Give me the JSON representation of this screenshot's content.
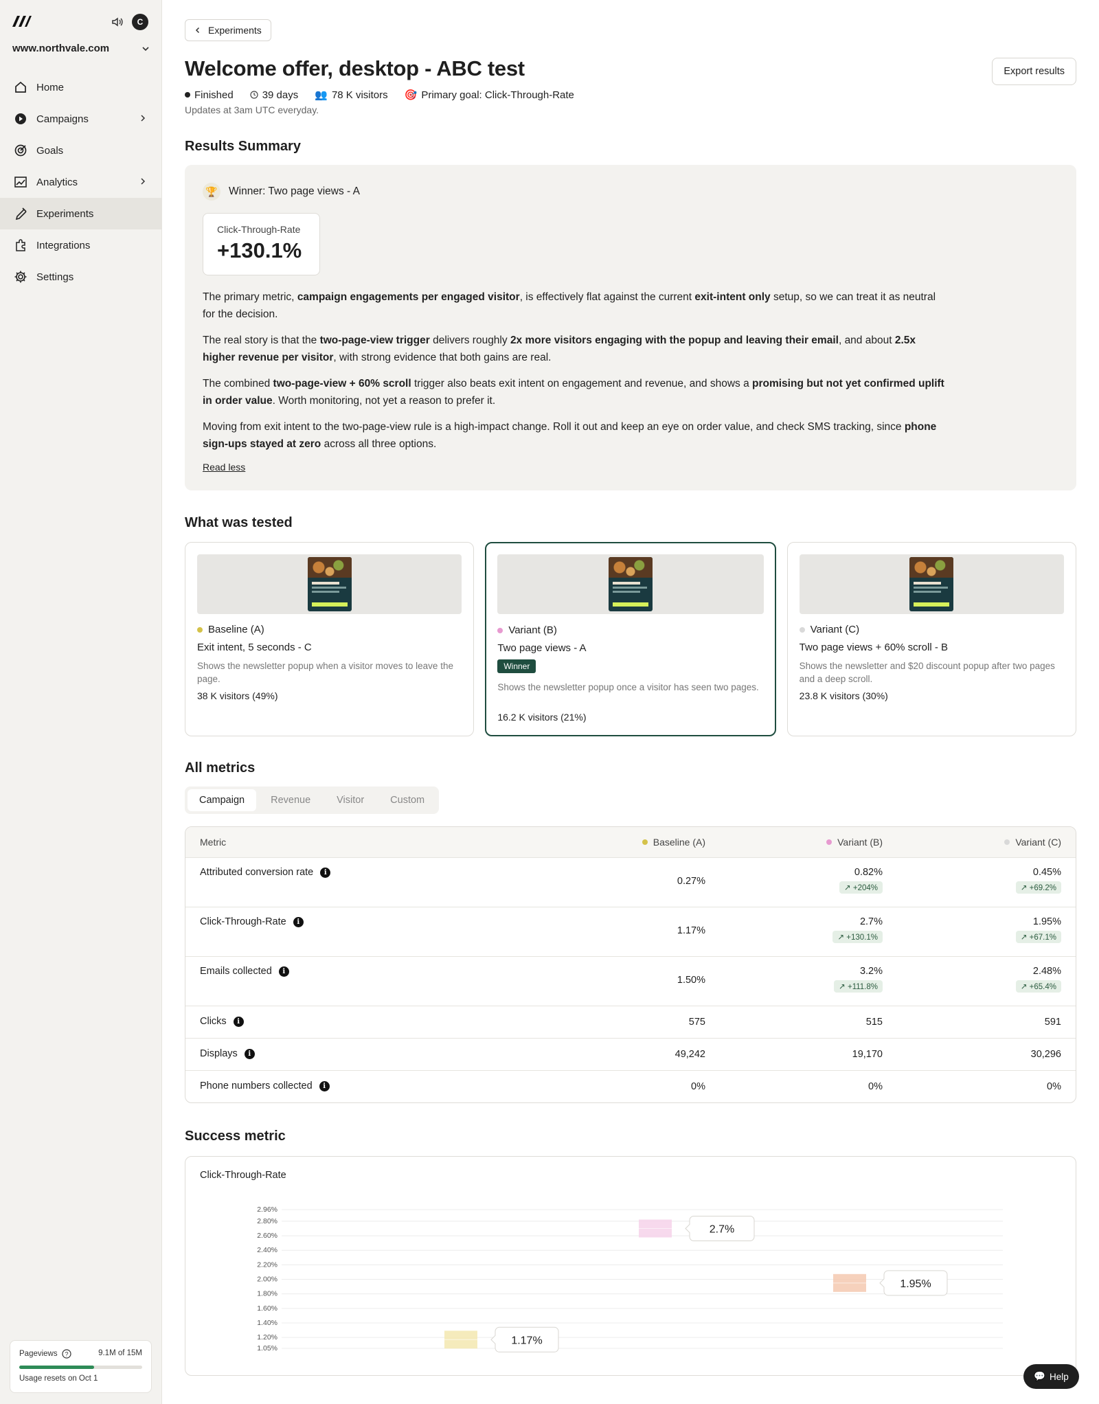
{
  "sidebar": {
    "avatar_initial": "C",
    "site": "www.northvale.com",
    "nav": [
      {
        "label": "Home"
      },
      {
        "label": "Campaigns"
      },
      {
        "label": "Goals"
      },
      {
        "label": "Analytics"
      },
      {
        "label": "Experiments"
      },
      {
        "label": "Integrations"
      },
      {
        "label": "Settings"
      }
    ],
    "usage": {
      "label": "Pageviews",
      "value": "9.1M of 15M",
      "fraction": 0.61,
      "note": "Usage resets on Oct 1"
    }
  },
  "header": {
    "back_label": "Experiments",
    "title": "Welcome offer, desktop - ABC test",
    "export_label": "Export results",
    "status": "Finished",
    "duration": "39 days",
    "visitors": "78 K visitors",
    "goal": "Primary goal: Click-Through-Rate",
    "updates": "Updates at 3am UTC everyday."
  },
  "summary": {
    "heading": "Results Summary",
    "winner": "Winner: Two page views - A",
    "kpi_label": "Click-Through-Rate",
    "kpi_value": "+130.1%",
    "p1": {
      "a": "The primary metric, ",
      "b": "campaign engagements per engaged visitor",
      "c": ", is effectively flat against the current ",
      "d": "exit-intent only",
      "e": " setup, so we can treat it as neutral for the decision."
    },
    "p2": {
      "a": "The real story is that the ",
      "b": "two-page-view trigger",
      "c": " delivers roughly ",
      "d": "2x more visitors engaging with the popup and leaving their email",
      "e": ", and about ",
      "f": "2.5x higher revenue per visitor",
      "g": ", with strong evidence that both gains are real."
    },
    "p3": {
      "a": "The combined ",
      "b": "two-page-view + 60% scroll",
      "c": " trigger also beats exit intent on engagement and revenue, and shows a ",
      "d": "promising but not yet confirmed uplift in order value",
      "e": ". Worth monitoring, not yet a reason to prefer it."
    },
    "p4": {
      "a": "Moving from exit intent to the two-page-view rule is a high-impact change. Roll it out and keep an eye on order value, and check SMS tracking, since ",
      "b": "phone sign-ups stayed at zero",
      "c": " across all three options."
    },
    "read_less": "Read less"
  },
  "tested": {
    "heading": "What was tested",
    "variants": [
      {
        "name": "Baseline (A)",
        "color": "#d4c24a",
        "subtitle": "Exit intent, 5 seconds - C",
        "description": "Shows the newsletter popup when a visitor moves to leave the page.",
        "visitors": "38 K visitors (49%)"
      },
      {
        "name": "Variant (B)",
        "color": "#e79ad0",
        "subtitle": "Two page views - A",
        "badge": "Winner",
        "description": "Shows the newsletter popup once a visitor has seen two pages.",
        "visitors": "16.2 K visitors (21%)"
      },
      {
        "name": "Variant (C)",
        "color": "#d9d9d9",
        "subtitle": "Two page views + 60% scroll - B",
        "description": "Shows the newsletter and $20 discount popup after two pages and a deep scroll.",
        "visitors": "23.8 K visitors (30%)"
      }
    ]
  },
  "metrics": {
    "heading": "All metrics",
    "tabs": [
      "Campaign",
      "Revenue",
      "Visitor",
      "Custom"
    ],
    "columns": [
      "Metric",
      "Baseline (A)",
      "Variant (B)",
      "Variant (C)"
    ],
    "rows": [
      {
        "name": "Attributed conversion rate",
        "a": "0.27%",
        "b": "0.82%",
        "b_delta": "↗ +204%",
        "c": "0.45%",
        "c_delta": "↗ +69.2%"
      },
      {
        "name": "Click-Through-Rate",
        "a": "1.17%",
        "b": "2.7%",
        "b_delta": "↗ +130.1%",
        "c": "1.95%",
        "c_delta": "↗ +67.1%"
      },
      {
        "name": "Emails collected",
        "a": "1.50%",
        "b": "3.2%",
        "b_delta": "↗ +111.8%",
        "c": "2.48%",
        "c_delta": "↗ +65.4%"
      },
      {
        "name": "Clicks",
        "a": "575",
        "b": "515",
        "c": "591"
      },
      {
        "name": "Displays",
        "a": "49,242",
        "b": "19,170",
        "c": "30,296"
      },
      {
        "name": "Phone numbers collected",
        "a": "0%",
        "b": "0%",
        "c": "0%"
      }
    ]
  },
  "success": {
    "heading": "Success metric",
    "card_title": "Click-Through-Rate"
  },
  "chart_data": {
    "type": "scatter",
    "title": "Click-Through-Rate",
    "y_ticks": [
      "2.96%",
      "2.80%",
      "2.60%",
      "2.40%",
      "2.20%",
      "2.00%",
      "1.80%",
      "1.60%",
      "1.40%",
      "1.20%",
      "1.05%"
    ],
    "y_tick_values": [
      2.96,
      2.8,
      2.6,
      2.4,
      2.2,
      2.0,
      1.8,
      1.6,
      1.4,
      1.2,
      1.05
    ],
    "ylim": [
      1.05,
      2.96
    ],
    "series": [
      {
        "name": "Baseline (A)",
        "value": 1.17,
        "label": "1.17%",
        "color": "#f3e7b0"
      },
      {
        "name": "Variant (B)",
        "value": 2.7,
        "label": "2.7%",
        "color": "#f6d2ea"
      },
      {
        "name": "Variant (C)",
        "value": 1.95,
        "label": "1.95%",
        "color": "#f4c9b0"
      }
    ],
    "grid": true
  },
  "help_label": "Help"
}
